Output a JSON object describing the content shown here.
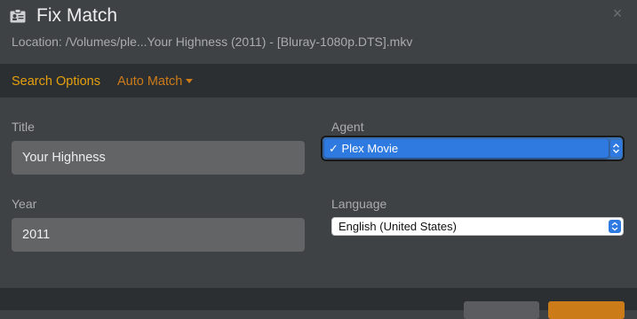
{
  "dialog": {
    "title": "Fix Match",
    "location": "Location: /Volumes/ple...Your Highness (2011) - [Bluray-1080p.DTS].mkv",
    "close_glyph": "×"
  },
  "tabs": {
    "search_options": "Search Options",
    "auto_match": "Auto Match"
  },
  "form": {
    "title_label": "Title",
    "title_value": "Your Highness",
    "year_label": "Year",
    "year_value": "2011",
    "agent_label": "Agent",
    "agent_value": "✓ Plex Movie",
    "language_label": "Language",
    "language_value": "English (United States)"
  },
  "colors": {
    "accent": "#e5a00d",
    "accent_dark": "#cc7b19",
    "select_blue": "#2e7ae0"
  },
  "icons": {
    "title": "id-card-icon",
    "close": "close-icon",
    "dropdown": "caret-down-icon",
    "stepper": "up-down-stepper-icon"
  }
}
